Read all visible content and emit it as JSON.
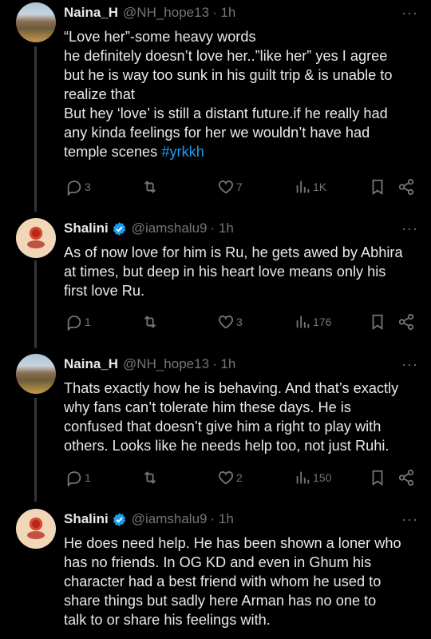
{
  "tweets": [
    {
      "name": "Naina_H",
      "handle": "@NH_hope13",
      "time": "· 1h",
      "verified": false,
      "lines": [
        "“Love her”-some heavy words",
        "he definitely doesn’t love her..”like her” yes I agree",
        "but he is way too sunk in his guilt trip & is unable to",
        "realize that",
        "But hey ‘love’ is still a distant future.if he really had",
        "any kinda feelings for her we wouldn’t have had",
        "temple scenes "
      ],
      "hashtag": "#yrkkh",
      "replies": "3",
      "reposts": "",
      "likes": "7",
      "views": "1K"
    },
    {
      "name": "Shalini",
      "handle": "@iamshalu9",
      "time": "· 1h",
      "verified": true,
      "lines": [
        "As of now love for him is Ru, he gets awed by Abhira",
        "at times, but deep in his heart love means only his",
        "first love Ru."
      ],
      "replies": "1",
      "reposts": "",
      "likes": "3",
      "views": "176"
    },
    {
      "name": "Naina_H",
      "handle": "@NH_hope13",
      "time": "· 1h",
      "verified": false,
      "lines": [
        "Thats exactly how he is behaving. And that’s exactly",
        "why fans can’t tolerate him these days. He is",
        "confused that doesn’t give him a right to play with",
        "others. Looks like he needs help too, not just Ruhi."
      ],
      "replies": "1",
      "reposts": "",
      "likes": "2",
      "views": "150"
    },
    {
      "name": "Shalini",
      "handle": "@iamshalu9",
      "time": "· 1h",
      "verified": true,
      "lines": [
        "He does need help. He has been shown a loner who",
        "has no friends. In OG KD and even in Ghum his",
        "character had a best friend with whom he used to",
        "share things but sadly here Arman has no one to",
        "talk to or share his feelings with."
      ]
    }
  ],
  "more_label": "···",
  "colors": {
    "accent": "#1d9bf0",
    "muted": "#71767b",
    "text": "#e7e9ea",
    "bg": "#000000"
  }
}
